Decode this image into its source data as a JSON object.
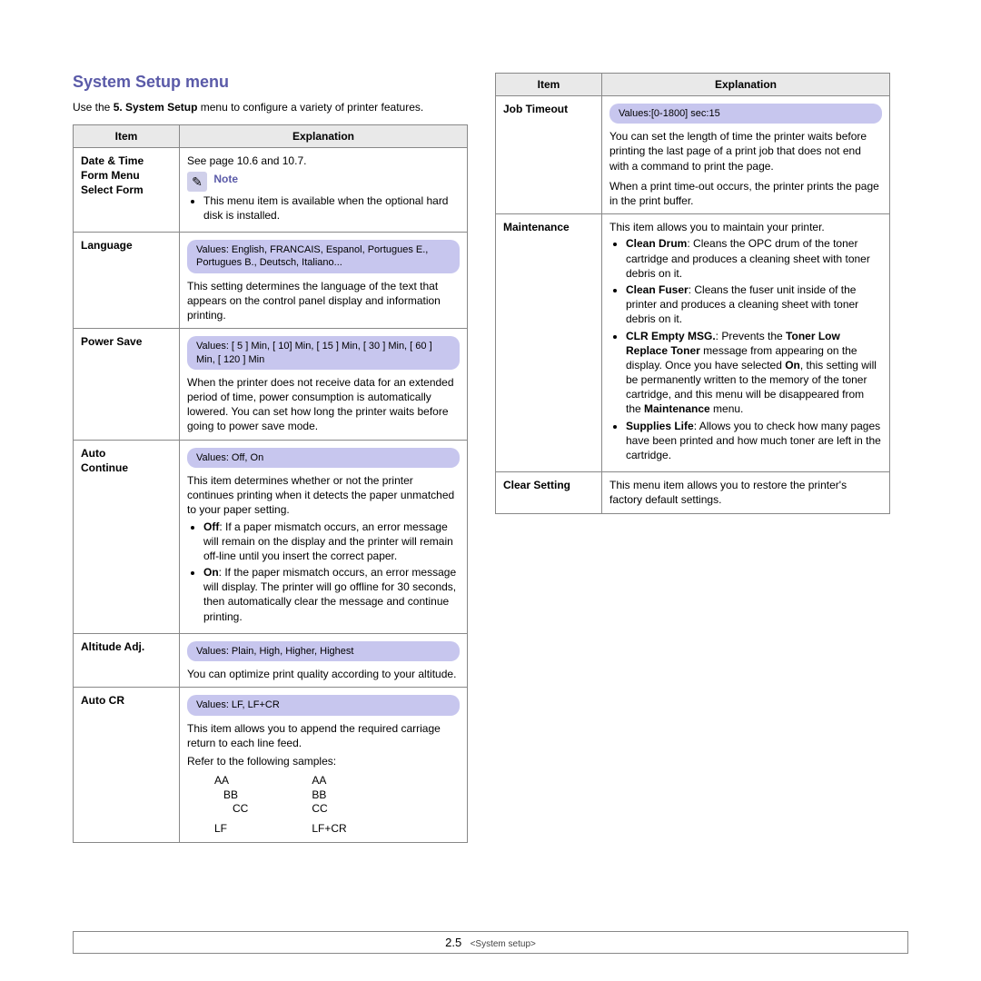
{
  "title": "System Setup menu",
  "intro_a": "Use the ",
  "intro_b": "5. System Setup",
  "intro_c": " menu to configure a variety of printer features.",
  "hdr_item": "Item",
  "hdr_expl": "Explanation",
  "left": {
    "r1": {
      "item1": "Date & Time",
      "item2": "Form Menu",
      "item3": "Select Form",
      "expl_line1": "See page 10.6 and 10.7.",
      "note": "Note",
      "note_bullet": "This menu item is available when the optional hard disk is installed."
    },
    "r2": {
      "item": "Language",
      "values": "Values: English, FRANCAIS, Espanol, Portugues E., Portugues B., Deutsch, Italiano...",
      "desc": "This setting determines the language of the text that appears on the control panel display and information printing."
    },
    "r3": {
      "item": "Power Save",
      "values": "Values: [ 5 ] Min, [ 10] Min, [ 15 ] Min, [ 30 ] Min, [ 60 ] Min, [ 120 ] Min",
      "desc": "When the printer does not receive data for an extended period of time, power consumption is automatically lowered. You can set how long the printer waits before going to power save mode."
    },
    "r4": {
      "item1": "Auto",
      "item2": "Continue",
      "values": "Values: Off, On",
      "desc": "This item determines whether or not the printer continues printing when it detects the paper unmatched to your paper setting.",
      "b1a": "Off",
      "b1b": ": If a paper mismatch occurs, an error message will remain on the display and the printer will remain off-line until you insert the correct paper.",
      "b2a": "On",
      "b2b": ": If the paper mismatch occurs, an error message will display. The printer will go offline for 30 seconds, then automatically clear the message and continue printing."
    },
    "r5": {
      "item": "Altitude Adj.",
      "values": "Values: Plain, High, Higher, Highest",
      "desc": "You can optimize print quality according to your altitude."
    },
    "r6": {
      "item": "Auto CR",
      "values": "Values: LF, LF+CR",
      "desc1": "This item allows you to append the required carriage return to each line feed.",
      "desc2": "Refer to the following samples:",
      "s1l1": "AA",
      "s1l2": "   BB",
      "s1l3": "      CC",
      "s1lab": "LF",
      "s2l1": "AA",
      "s2l2": "BB",
      "s2l3": "CC",
      "s2lab": "LF+CR"
    }
  },
  "right": {
    "r1": {
      "item": "Job Timeout",
      "values": "Values:[0-1800] sec:15",
      "desc1": "You can set the length of time the printer waits before printing the last page of a print job that does not end with a command to print the page.",
      "desc2": "When a print time-out occurs, the printer prints the page in the print buffer."
    },
    "r2": {
      "item": "Maintenance",
      "desc": "This item allows you to maintain your printer.",
      "b1a": "Clean Drum",
      "b1b": ": Cleans the OPC drum of the toner cartridge and produces a cleaning sheet with toner debris on it.",
      "b2a": "Clean Fuser",
      "b2b": ": Cleans the fuser unit inside of the printer and produces a cleaning sheet with toner debris on it.",
      "b3a": "CLR Empty MSG.",
      "b3b": ": Prevents the ",
      "b3c": "Toner Low Replace Toner",
      "b3d": " message from appearing on the display. Once you have selected ",
      "b3e": "On",
      "b3f": ", this setting will be permanently written to the memory of the toner cartridge, and this menu will be disappeared from the ",
      "b3g": "Maintenance",
      "b3h": " menu.",
      "b4a": "Supplies Life",
      "b4b": ": Allows you to check how many pages have been printed and how much toner are left in the cartridge."
    },
    "r3": {
      "item": "Clear Setting",
      "desc": "This menu item allows you to restore the printer's factory default settings."
    }
  },
  "footer_page": "2.5",
  "footer_sec": "<System setup>"
}
